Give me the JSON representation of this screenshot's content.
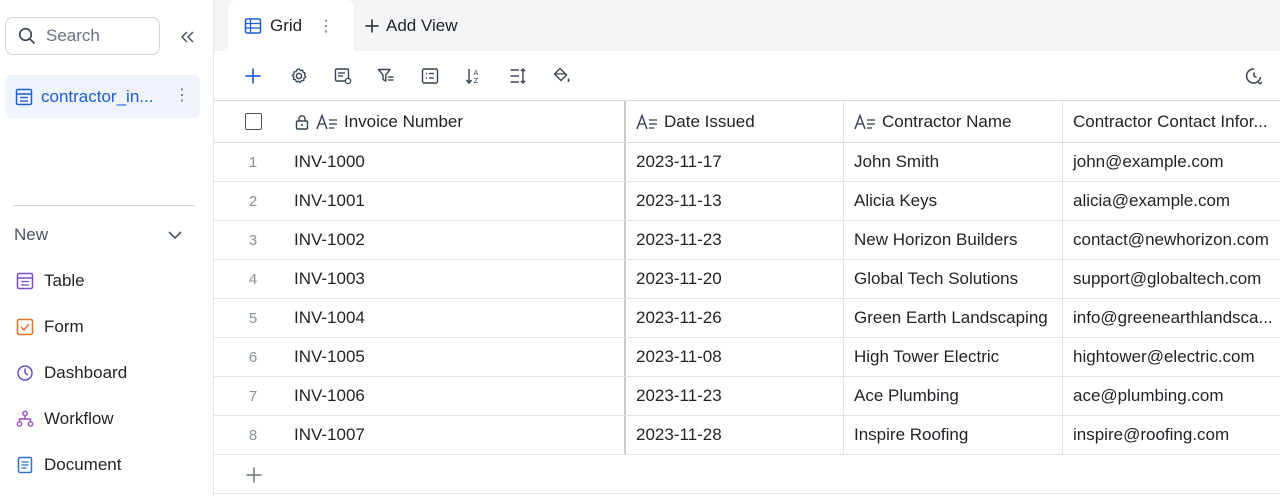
{
  "sidebar": {
    "search_placeholder": "Search",
    "table_item": "contractor_in...",
    "new_label": "New",
    "menu": [
      {
        "label": "Table",
        "icon": "table-icon"
      },
      {
        "label": "Form",
        "icon": "form-icon"
      },
      {
        "label": "Dashboard",
        "icon": "dashboard-icon"
      },
      {
        "label": "Workflow",
        "icon": "workflow-icon"
      },
      {
        "label": "Document",
        "icon": "document-icon"
      }
    ]
  },
  "tabs": {
    "grid_label": "Grid",
    "add_view_label": "Add View"
  },
  "grid": {
    "columns": [
      "Invoice Number",
      "Date Issued",
      "Contractor Name",
      "Contractor Contact Infor..."
    ],
    "rows": [
      {
        "num": "1",
        "invoice": "INV-1000",
        "date": "2023-11-17",
        "name": "John Smith",
        "contact": "john@example.com"
      },
      {
        "num": "2",
        "invoice": "INV-1001",
        "date": "2023-11-13",
        "name": "Alicia Keys",
        "contact": "alicia@example.com"
      },
      {
        "num": "3",
        "invoice": "INV-1002",
        "date": "2023-11-23",
        "name": "New Horizon Builders",
        "contact": "contact@newhorizon.com"
      },
      {
        "num": "4",
        "invoice": "INV-1003",
        "date": "2023-11-20",
        "name": "Global Tech Solutions",
        "contact": "support@globaltech.com"
      },
      {
        "num": "5",
        "invoice": "INV-1004",
        "date": "2023-11-26",
        "name": "Green Earth Landscaping",
        "contact": "info@greenearthlandsca..."
      },
      {
        "num": "6",
        "invoice": "INV-1005",
        "date": "2023-11-08",
        "name": "High Tower Electric",
        "contact": "hightower@electric.com"
      },
      {
        "num": "7",
        "invoice": "INV-1006",
        "date": "2023-11-23",
        "name": "Ace Plumbing",
        "contact": "ace@plumbing.com"
      },
      {
        "num": "8",
        "invoice": "INV-1007",
        "date": "2023-11-28",
        "name": "Inspire Roofing",
        "contact": "inspire@roofing.com"
      }
    ]
  },
  "colors": {
    "accent": "#1d5fd6",
    "selected_bg": "#eef3fc",
    "table_icon": "#7c4dcc",
    "form_icon": "#e8702a",
    "dashboard_icon": "#6d4bd8",
    "workflow_icon": "#9b4dca",
    "document_icon": "#2f6fd6"
  }
}
